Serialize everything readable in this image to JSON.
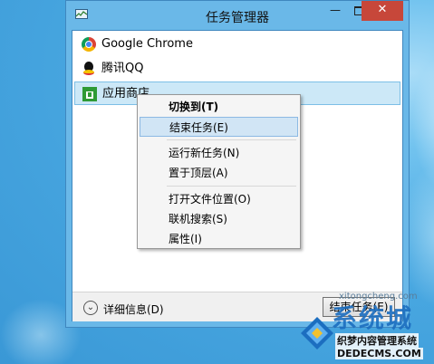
{
  "window": {
    "title": "任务管理器",
    "controls": {
      "minimize": "—",
      "close": "✕"
    }
  },
  "apps": [
    {
      "name": "Google Chrome",
      "icon": "chrome-icon"
    },
    {
      "name": "腾讯QQ",
      "icon": "qq-icon"
    },
    {
      "name": "应用商店",
      "icon": "store-icon",
      "selected": true
    }
  ],
  "context_menu": {
    "items": [
      {
        "label": "切换到(T)",
        "bold": true
      },
      {
        "label": "结束任务(E)",
        "hover": true
      },
      {
        "label": "运行新任务(N)"
      },
      {
        "label": "置于顶层(A)"
      },
      {
        "label": "打开文件位置(O)"
      },
      {
        "label": "联机搜索(S)"
      },
      {
        "label": "属性(I)"
      }
    ]
  },
  "footer": {
    "details_label": "详细信息(D)",
    "end_task_label": "结束任务(E)"
  },
  "watermark": {
    "brand": "系统城",
    "url": "xitongcheng.com",
    "cn_text": "织梦内容管理系统",
    "url2": "DEDECMS.COM"
  },
  "colors": {
    "close_button": "#c7473a",
    "selection": "#cce8f7",
    "menu_hover": "#d1e5f5",
    "window_frame": "#6ab8e8"
  }
}
